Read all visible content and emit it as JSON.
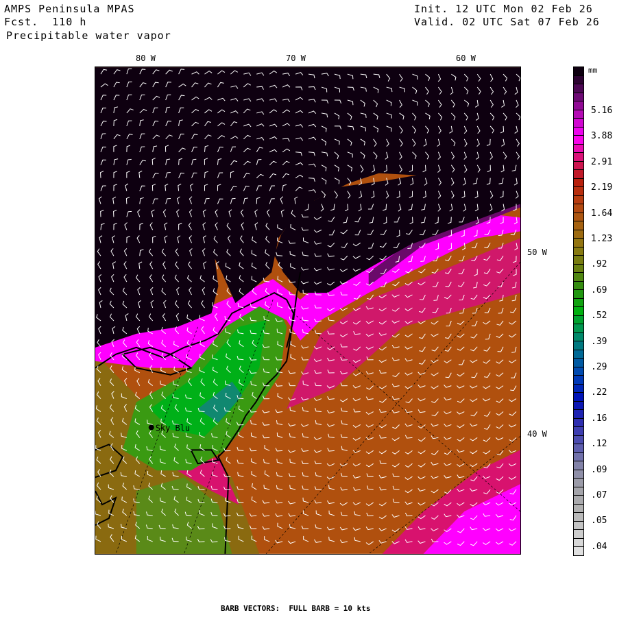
{
  "header": {
    "model": "AMPS Peninsula MPAS",
    "forecast": "Fcst.  110 h",
    "field": "Precipitable water vapor",
    "init": "Init. 12 UTC Mon 02 Feb 26",
    "valid": "Valid. 02 UTC Sat 07 Feb 26"
  },
  "axes": {
    "top_labels": [
      "80 W",
      "70 W",
      "60 W"
    ],
    "right_labels": [
      "50 W",
      "40 W"
    ]
  },
  "station": {
    "name": "Sky Blu"
  },
  "colorbar": {
    "unit": "mm",
    "labels": [
      "5.16",
      "3.88",
      "2.91",
      "2.19",
      "1.64",
      "1.23",
      ".92",
      ".69",
      ".52",
      ".39",
      ".29",
      ".22",
      ".16",
      ".12",
      ".09",
      ".07",
      ".05",
      ".04"
    ],
    "stops": [
      "#0e0010",
      "#5e0a66",
      "#b80ab8",
      "#ff00ff",
      "#d8126e",
      "#b81c0c",
      "#b84010",
      "#a86010",
      "#907810",
      "#6a7e10",
      "#2a9010",
      "#00b010",
      "#009060",
      "#006898",
      "#0040b8",
      "#0010b8",
      "#2a2ab0",
      "#5050b0",
      "#8080a8",
      "#a0a0a8",
      "#b0b0b0",
      "#c8c8c8",
      "#e0e0e0"
    ]
  },
  "footer": "BARB VECTORS:  FULL BARB = 10 kts"
}
